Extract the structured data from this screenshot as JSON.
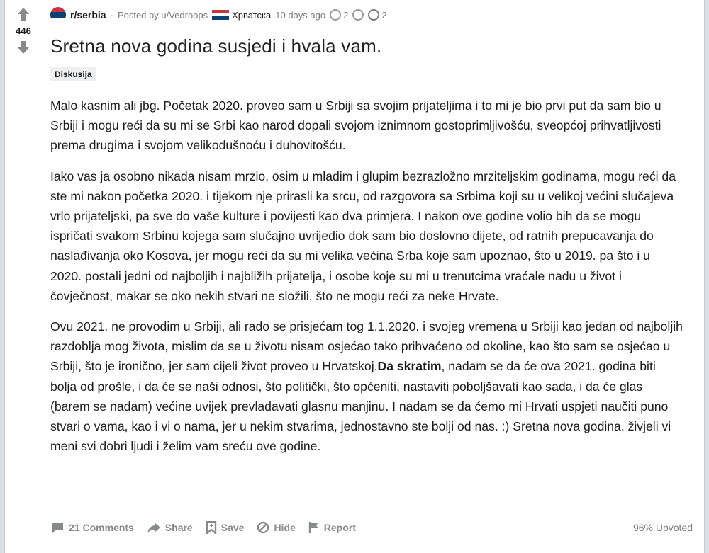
{
  "post": {
    "score": "446",
    "subreddit": "r/serbia",
    "posted_by": "Posted by u/Vedroops",
    "user_flair": "Хрватска",
    "age": "10 days ago",
    "award_count_1": "2",
    "award_count_2": "2",
    "title": "Sretna nova godina susjedi i hvala vam.",
    "post_flair": "Diskusija",
    "paragraphs": {
      "p1": "Malo kasnim ali jbg. Početak 2020. proveo sam u Srbiji sa svojim prijateljima i to mi je bio prvi put da sam bio u Srbiji i mogu reći da su mi se Srbi kao narod dopali svojom iznimnom gostoprimljivošću, sveopćoj prihvatljivosti prema drugima i svojom velikodušnoću i duhovitošću.",
      "p2": "Iako vas ja osobno nikada nisam mrzio, osim u mladim i glupim bezrazložno mrziteljskim godinama, mogu reći da ste mi nakon početka 2020. i tijekom nje prirasli ka srcu, od razgovora sa Srbima koji su u velikoj većini slučajeva vrlo prijateljski, pa sve do vaše kulture i povijesti kao dva primjera. I nakon ove godine volio bih da se mogu ispričati svakom Srbinu kojega sam slučajno uvrijedio dok sam bio doslovno dijete, od ratnih prepucavanja do naslađivanja oko Kosova, jer mogu reći da su mi velika većina Srba koje sam upoznao, što u 2019. pa što i u 2020. postali jedni od najboljih i najbližih prijatelja, i osobe koje su mi u trenutcima vraćale nadu u život i čovječnost, makar se oko nekih stvari ne složili, što ne mogu reći za neke Hrvate.",
      "p3_a": "Ovu 2021. ne provodim u Srbiji, ali rado se prisjećam tog 1.1.2020. i svojeg vremena u Srbiji kao jedan od najboljih razdoblja mog života, mislim da se u životu nisam osjećao tako prihvaćeno od okoline, kao što sam se osjećao u Srbiji, što je ironično, jer sam cijeli život proveo u Hrvatskoj.",
      "p3_bold": "Da skratim",
      "p3_b": ", nadam se da će ova 2021. godina biti bolja od prošle, i da će se naši odnosi, što politički, što općeniti, nastaviti poboljšavati kao sada, i da će glas (barem se nadam) većine uvijek prevladavati glasnu manjinu. I nadam se da ćemo mi Hrvati uspjeti naučiti puno stvari o vama, kao i vi o nama, jer u nekim stvarima, jednostavno ste bolji od nas. :) Sretna nova godina, živjeli vi meni svi dobri ljudi i želim vam sreću ove godine."
    }
  },
  "footer": {
    "comments": "21 Comments",
    "share": "Share",
    "save": "Save",
    "hide": "Hide",
    "report": "Report",
    "upvoted": "96% Upvoted"
  },
  "colors": {
    "background": "#dae0e6",
    "card": "#ffffff",
    "meta_text": "#7c7c7c",
    "action_text": "#878a8c",
    "flag_red": "#c6363c",
    "flag_blue": "#0c4076"
  },
  "icons": [
    "upvote-arrow-icon",
    "downvote-arrow-icon",
    "subreddit-icon",
    "croatia-flag-icon",
    "award-icon",
    "comment-icon",
    "share-icon",
    "save-icon",
    "hide-icon",
    "report-icon"
  ]
}
